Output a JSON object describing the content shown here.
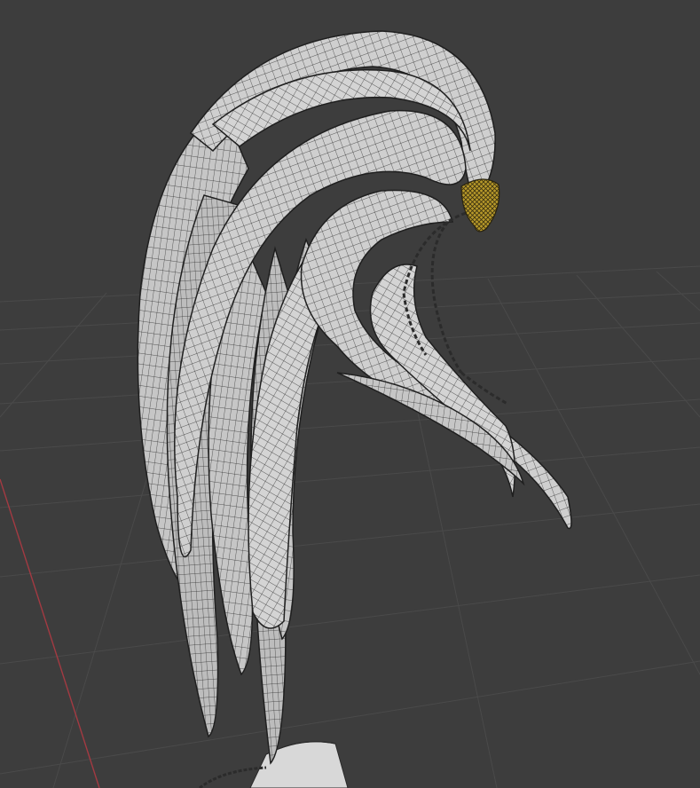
{
  "viewport": {
    "background_color": "#3d3d3d",
    "grid_color": "#4a4a4a",
    "x_axis_color": "#a33a42",
    "mesh_fill_color": "#cfcfcf",
    "wireframe_color": "#2a2a2a",
    "chain_color": "#2b2b2b",
    "ornament_color": "#b89a2a",
    "pedestal_color": "#d8d8d8"
  }
}
